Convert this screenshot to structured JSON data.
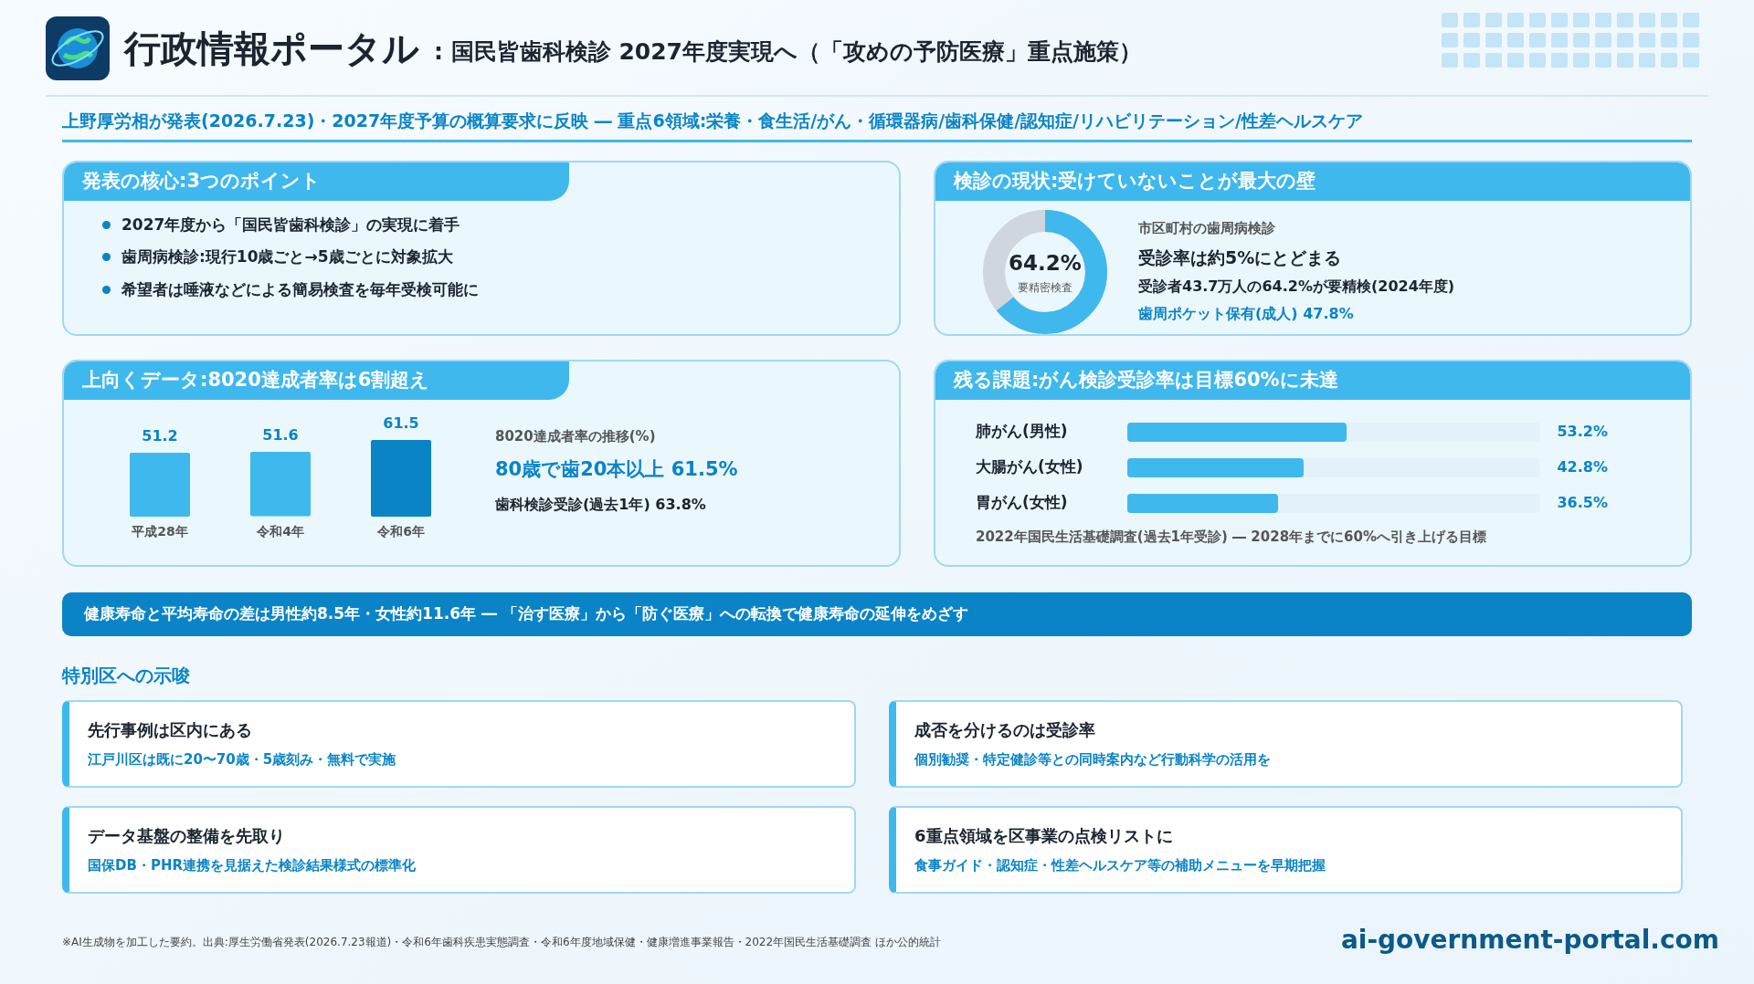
{
  "header": {
    "title": "行政情報ポータル",
    "subtitle": ": 国民皆歯科検診 2027年度実現へ（「攻めの予防医療」重点施策）"
  },
  "lead": "上野厚労相が発表(2026.7.23)・2027年度予算の概算要求に反映 ― 重点6領域:栄養・食生活/がん・循環器病/歯科保健/認知症/リハビリテーション/性差ヘルスケア",
  "points_card": {
    "title": "発表の核心:3つのポイント",
    "items": [
      "2027年度から「国民皆歯科検診」の実現に着手",
      "歯周病検診:現行10歳ごと→5歳ごとに対象拡大",
      "希望者は唾液などによる簡易検査を毎年受検可能に"
    ]
  },
  "status_card": {
    "title": "検診の現状:受けていないことが最大の壁",
    "donut": {
      "value": "64.2%",
      "label": "要精密検査",
      "level": 0.642
    },
    "caption": "市区町村の歯周病検診",
    "headline": "受診率は約5%にとどまる",
    "detail": "受診者43.7万人の64.2%が要精検(2024年度)",
    "highlight": "歯周ポケット保有(成人) 47.8%"
  },
  "trend_card": {
    "title": "上向くデータ:8020達成者率は6割超え",
    "chart_data": {
      "type": "bar",
      "categories": [
        "平成28年",
        "令和4年",
        "令和6年"
      ],
      "values": [
        51.2,
        51.6,
        61.5
      ],
      "data_labels": true
    },
    "caption": "8020達成者率の推移(%)",
    "headline": "80歳で歯20本以上 61.5%",
    "detail": "歯科検診受診(過去1年) 63.8%"
  },
  "cancer_card": {
    "title": "残る課題:がん検診受診率は目標60%に未達",
    "rows": [
      {
        "name": "肺がん(男性)",
        "level": 0.532,
        "reading": "53.2%"
      },
      {
        "name": "大腸がん(女性)",
        "level": 0.428,
        "reading": "42.8%"
      },
      {
        "name": "胃がん(女性)",
        "level": 0.365,
        "reading": "36.5%"
      }
    ],
    "note": "2022年国民生活基礎調査(過去1年受診) ― 2028年までに60%へ引き上げる目標"
  },
  "banner": "健康寿命と平均寿命の差は男性約8.5年・女性約11.6年 ― 「治す医療」から「防ぐ医療」への転換で健康寿命の延伸をめざす",
  "implications": {
    "title": "特別区への示唆",
    "cards": [
      {
        "title": "先行事例は区内にある",
        "text": "江戸川区は既に20〜70歳・5歳刻み・無料で実施"
      },
      {
        "title": "成否を分けるのは受診率",
        "text": "個別勧奨・特定健診等との同時案内など行動科学の活用を"
      },
      {
        "title": "データ基盤の整備を先取り",
        "text": "国保DB・PHR連携を見据えた検診結果様式の標準化"
      },
      {
        "title": "6重点領域を区事業の点検リストに",
        "text": "食事ガイド・認知症・性差ヘルスケア等の補助メニューを早期把握"
      }
    ]
  },
  "footer": {
    "note": "※AI生成物を加工した要約。出典:厚生労働省発表(2026.7.23報道)・令和6年歯科疾患実態調査・令和6年度地域保健・健康増進事業報告・2022年国民生活基礎調査 ほか公的統計",
    "site": "ai-government-portal.com"
  }
}
